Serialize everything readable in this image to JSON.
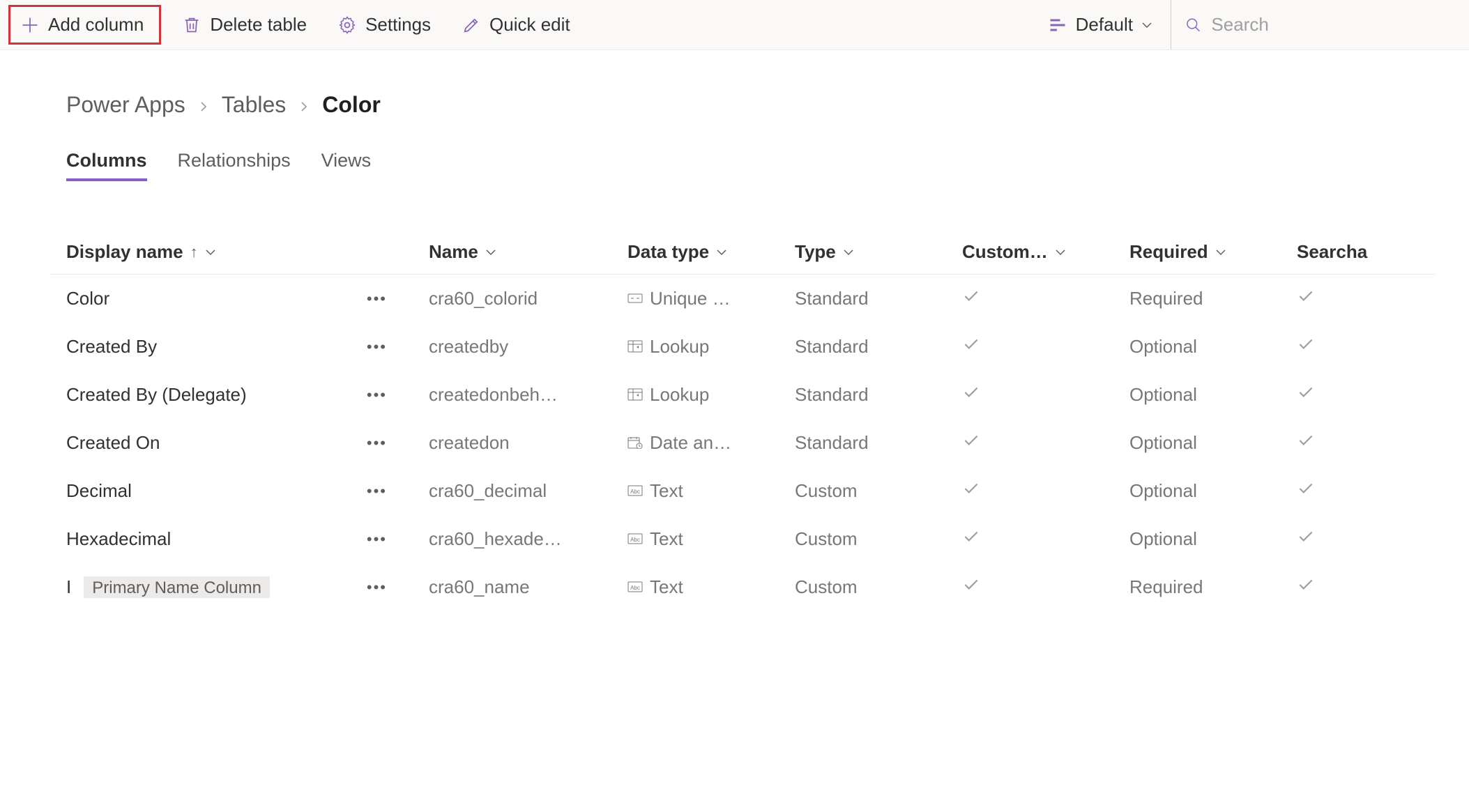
{
  "toolbar": {
    "add_column": "Add column",
    "delete_table": "Delete table",
    "settings": "Settings",
    "quick_edit": "Quick edit",
    "view_label": "Default",
    "search_placeholder": "Search"
  },
  "breadcrumb": {
    "items": [
      "Power Apps",
      "Tables",
      "Color"
    ]
  },
  "tabs": {
    "columns": "Columns",
    "relationships": "Relationships",
    "views": "Views"
  },
  "headers": {
    "display_name": "Display name",
    "name": "Name",
    "data_type": "Data type",
    "type": "Type",
    "custom": "Custom…",
    "required": "Required",
    "searchable": "Searcha"
  },
  "rows": [
    {
      "display": "Color",
      "name": "cra60_colorid",
      "datatype": "Unique …",
      "icon": "unique",
      "type": "Standard",
      "custom": true,
      "required": "Required",
      "searchable": true
    },
    {
      "display": "Created By",
      "name": "createdby",
      "datatype": "Lookup",
      "icon": "lookup",
      "type": "Standard",
      "custom": true,
      "required": "Optional",
      "searchable": true
    },
    {
      "display": "Created By (Delegate)",
      "name": "createdonbeh…",
      "datatype": "Lookup",
      "icon": "lookup",
      "type": "Standard",
      "custom": true,
      "required": "Optional",
      "searchable": true
    },
    {
      "display": "Created On",
      "name": "createdon",
      "datatype": "Date an…",
      "icon": "date",
      "type": "Standard",
      "custom": true,
      "required": "Optional",
      "searchable": true
    },
    {
      "display": "Decimal",
      "name": "cra60_decimal",
      "datatype": "Text",
      "icon": "text",
      "type": "Custom",
      "custom": true,
      "required": "Optional",
      "searchable": true
    },
    {
      "display": "Hexadecimal",
      "name": "cra60_hexade…",
      "datatype": "Text",
      "icon": "text",
      "type": "Custom",
      "custom": true,
      "required": "Optional",
      "searchable": true
    },
    {
      "display": "I",
      "pill": "Primary Name Column",
      "name": "cra60_name",
      "datatype": "Text",
      "icon": "text",
      "type": "Custom",
      "custom": true,
      "required": "Required",
      "searchable": true
    }
  ]
}
